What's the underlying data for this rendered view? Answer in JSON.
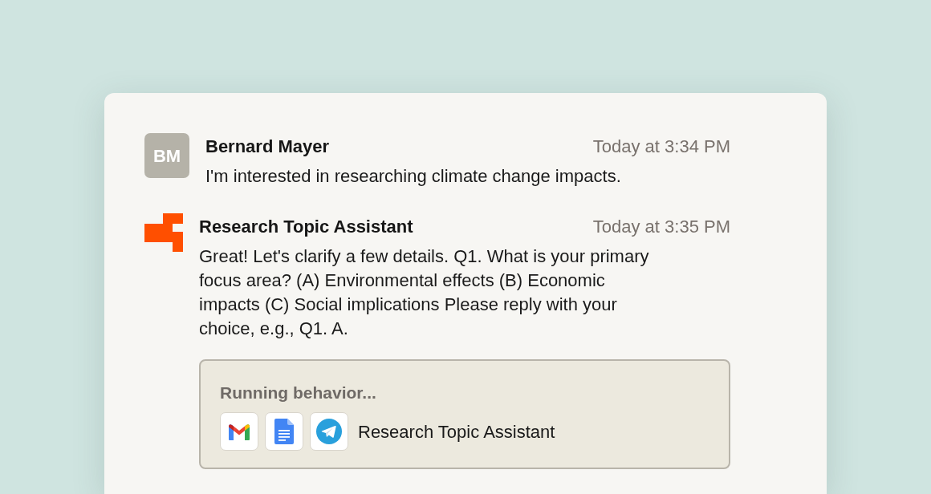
{
  "messages": [
    {
      "kind": "user",
      "avatar": "BM",
      "sender": "Bernard Mayer",
      "time": "Today at 3:34 PM",
      "text": "I'm interested in researching climate change impacts."
    },
    {
      "kind": "assistant",
      "sender": "Research Topic Assistant",
      "time": "Today at 3:35 PM",
      "text": "Great! Let's clarify a few details. Q1. What is your primary focus area? (A) Environmental effects (B) Economic impacts (C) Social implications Please reply with your choice, e.g., Q1. A.",
      "behavior": {
        "status": "Running behavior...",
        "apps": [
          {
            "kind": "mail"
          },
          {
            "kind": "document"
          },
          {
            "kind": "telegram"
          }
        ],
        "label": "Research Topic Assistant"
      }
    }
  ]
}
